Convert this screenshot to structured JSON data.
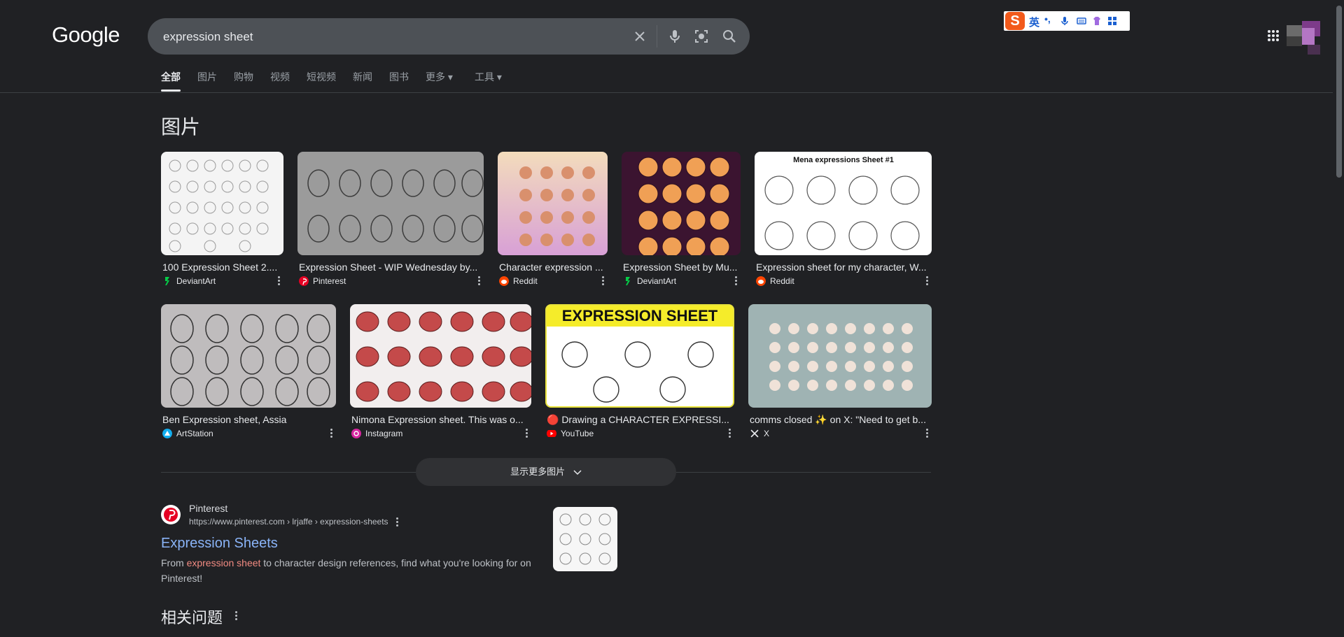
{
  "logo": "Google",
  "search": {
    "query": "expression sheet"
  },
  "ime": {
    "letter": "S",
    "mode": "英",
    "punct": "•,",
    "colors": {
      "brand": "#f25a1b",
      "accent": "#1a5fd0"
    }
  },
  "tabs": [
    {
      "label": "全部",
      "active": true
    },
    {
      "label": "图片"
    },
    {
      "label": "购物"
    },
    {
      "label": "视频"
    },
    {
      "label": "短视频"
    },
    {
      "label": "新闻"
    },
    {
      "label": "图书"
    },
    {
      "label": "更多 ▾"
    },
    {
      "label": "工具 ▾"
    }
  ],
  "images_heading": "图片",
  "images": [
    {
      "title": "100 Expression Sheet 2....",
      "source": "DeviantArt",
      "icon": "deviantart-icon"
    },
    {
      "title": "Expression Sheet - WIP Wednesday by...",
      "source": "Pinterest",
      "icon": "pinterest-icon"
    },
    {
      "title": "Character expression ...",
      "source": "Reddit",
      "icon": "reddit-icon"
    },
    {
      "title": "Expression Sheet by Mu...",
      "source": "DeviantArt",
      "icon": "deviantart-icon"
    },
    {
      "title": "Expression sheet for my character, W...",
      "source": "Reddit",
      "icon": "reddit-icon"
    },
    {
      "title": "Ben Expression sheet, Assia",
      "source": "ArtStation",
      "icon": "artstation-icon"
    },
    {
      "title": "Nimona Expression sheet. This was o...",
      "source": "Instagram",
      "icon": "instagram-icon"
    },
    {
      "title": "🔴 Drawing a CHARACTER EXPRESSI...",
      "source": "YouTube",
      "icon": "youtube-icon"
    },
    {
      "title": "comms closed ✨ on X: \"Need to get b...",
      "source": "X",
      "icon": "x-icon"
    }
  ],
  "image_overlays": {
    "card8_banner": "EXPRESSION SHEET",
    "card5_header": "Mena expressions Sheet #1"
  },
  "show_more": "显示更多图片",
  "result": {
    "site": "Pinterest",
    "url": "https://www.pinterest.com › lrjaffe › expression-sheets",
    "title": "Expression Sheets",
    "snippet_pre": "From ",
    "snippet_hl": "expression sheet",
    "snippet_post": " to character design references, find what you're looking for on Pinterest!"
  },
  "related_heading": "相关问题"
}
